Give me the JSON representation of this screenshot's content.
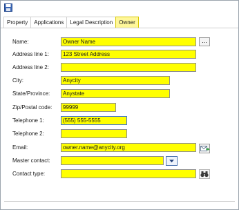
{
  "toolbar": {
    "save_icon": "floppy-disk-icon"
  },
  "tabs": [
    {
      "label": "Property"
    },
    {
      "label": "Applications"
    },
    {
      "label": "Legal Description"
    },
    {
      "label": "Owner",
      "active": true
    }
  ],
  "form": {
    "name": {
      "label": "Name:",
      "value": "Owner Name"
    },
    "address1": {
      "label": "Address line 1:",
      "value": "123 Street Address"
    },
    "address2": {
      "label": "Address line 2:",
      "value": ""
    },
    "city": {
      "label": "City:",
      "value": "Anycity"
    },
    "state": {
      "label": "State/Province:",
      "value": "Anystate"
    },
    "zip": {
      "label": "Zip/Postal code:",
      "value": "99999"
    },
    "phone1": {
      "label": "Telephone 1:",
      "value": "(555) 555-5555"
    },
    "phone2": {
      "label": "Telephone 2:",
      "value": ""
    },
    "email": {
      "label": "Email:",
      "value": "owner.name@anycity.org"
    },
    "master_contact": {
      "label": "Master contact:",
      "value": ""
    },
    "contact_type": {
      "label": "Contact type:",
      "value": ""
    }
  },
  "buttons": {
    "name_lookup": "...",
    "email_icon": "send-email-icon",
    "master_dropdown_icon": "chevron-down-icon",
    "contact_type_icon": "binoculars-icon"
  },
  "colors": {
    "field_fill": "#ffff00",
    "active_tab": "#fff799",
    "focus_border": "#3a6fd8"
  }
}
